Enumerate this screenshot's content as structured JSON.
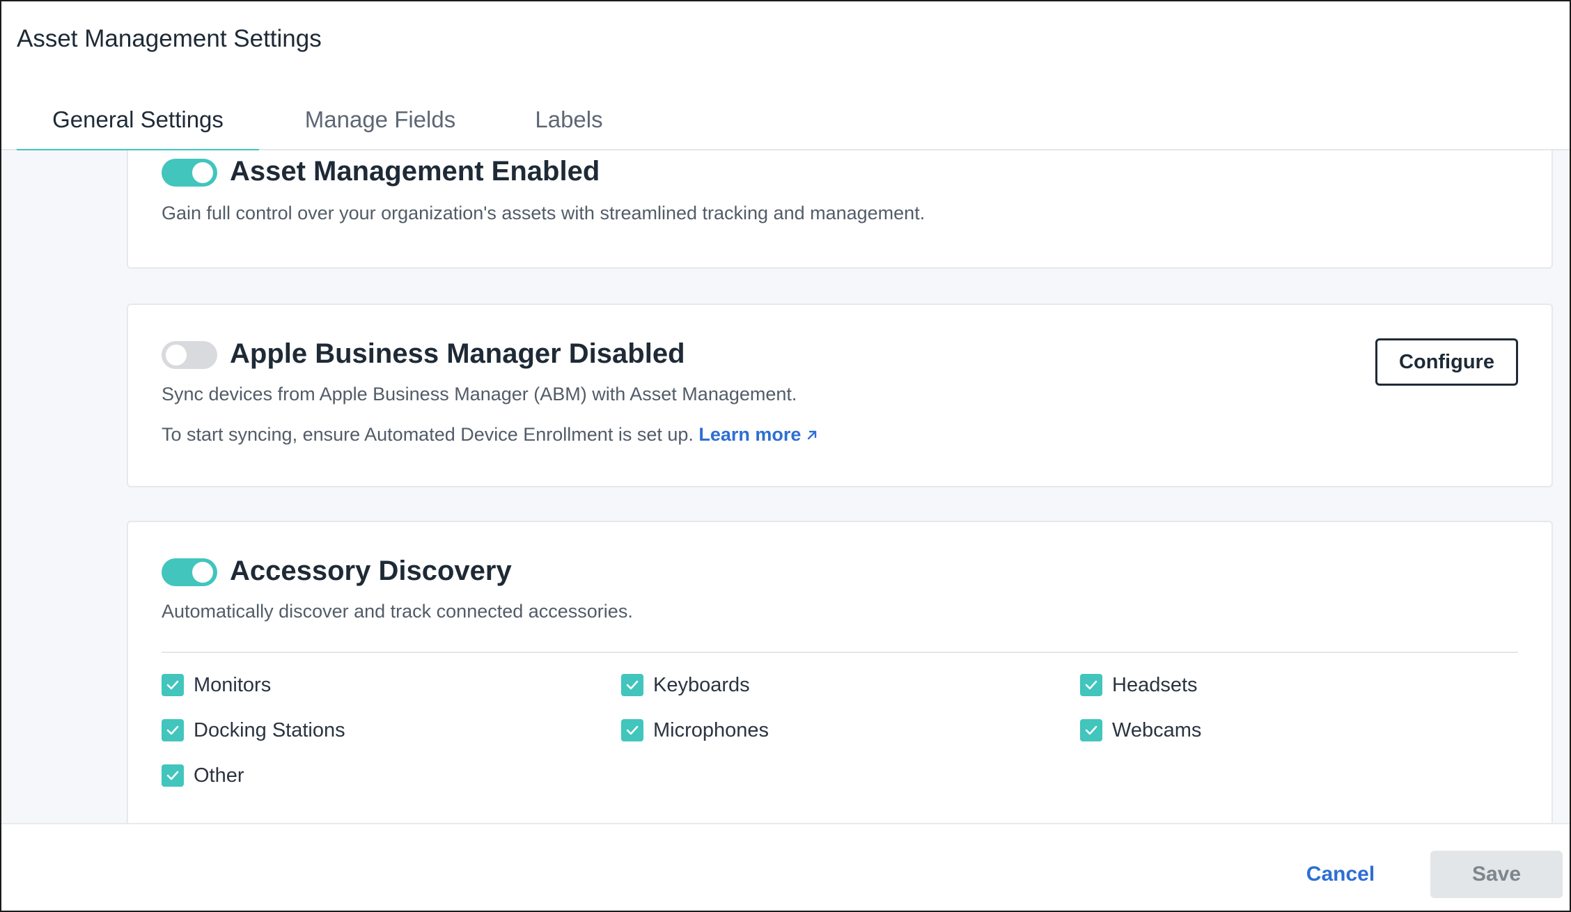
{
  "window": {
    "title": "Asset Management Settings"
  },
  "tabs": [
    {
      "label": "General Settings",
      "active": true
    },
    {
      "label": "Manage Fields",
      "active": false
    },
    {
      "label": "Labels",
      "active": false
    }
  ],
  "cards": {
    "asset_management": {
      "title": "Asset Management Enabled",
      "description": "Gain full control over your organization's assets with streamlined tracking and management.",
      "enabled": true
    },
    "apple_business_manager": {
      "title": "Apple Business Manager Disabled",
      "description": "Sync devices from Apple Business Manager (ABM) with Asset Management.",
      "note": "To start syncing, ensure Automated Device Enrollment is set up.",
      "link_label": "Learn more",
      "configure_label": "Configure",
      "enabled": false
    },
    "accessory_discovery": {
      "title": "Accessory Discovery",
      "description": "Automatically discover and track connected accessories.",
      "enabled": true,
      "accessories": [
        {
          "label": "Monitors",
          "checked": true
        },
        {
          "label": "Keyboards",
          "checked": true
        },
        {
          "label": "Headsets",
          "checked": true
        },
        {
          "label": "Docking Stations",
          "checked": true
        },
        {
          "label": "Microphones",
          "checked": true
        },
        {
          "label": "Webcams",
          "checked": true
        },
        {
          "label": "Other",
          "checked": true
        }
      ]
    }
  },
  "footer": {
    "cancel_label": "Cancel",
    "save_label": "Save"
  },
  "colors": {
    "accent": "#41c5bd",
    "link": "#2d6fd4",
    "toggle_off": "#d8dadd"
  }
}
